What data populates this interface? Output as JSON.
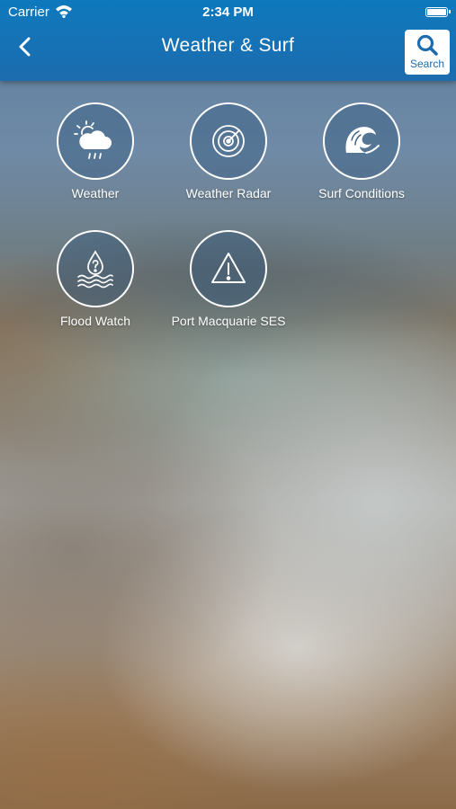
{
  "status_bar": {
    "carrier": "Carrier",
    "time": "2:34 PM",
    "battery_level": 1.0
  },
  "nav": {
    "title": "Weather & Surf",
    "back_icon": "chevron-left-icon",
    "search_label": "Search",
    "search_icon": "magnifier-icon"
  },
  "tiles": [
    {
      "label": "Weather",
      "icon": "sun-cloud-rain-icon"
    },
    {
      "label": "Weather Radar",
      "icon": "radar-icon"
    },
    {
      "label": "Surf Conditions",
      "icon": "wave-icon"
    },
    {
      "label": "Flood Watch",
      "icon": "flood-drop-icon"
    },
    {
      "label": "Port Macquarie SES",
      "icon": "warning-triangle-icon"
    }
  ],
  "colors": {
    "nav_bar": "#1c6cae",
    "icon_stroke": "#ffffff"
  }
}
